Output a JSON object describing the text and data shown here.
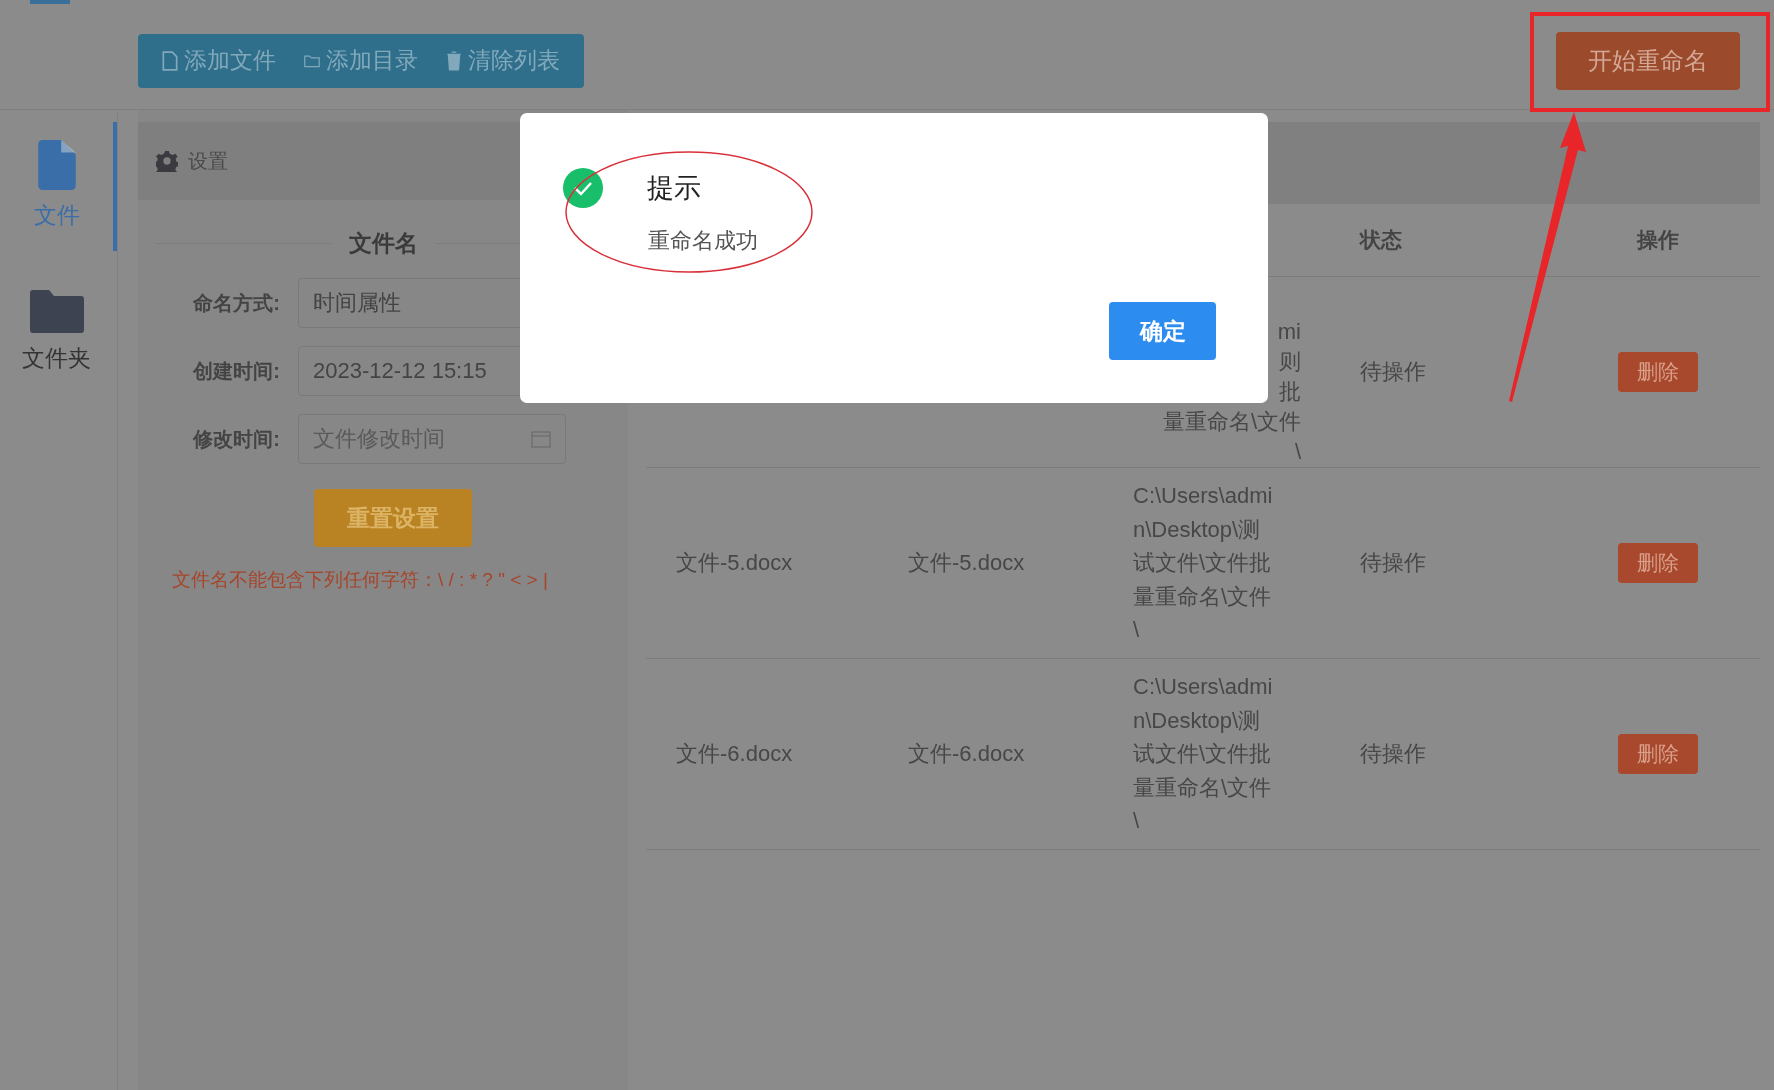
{
  "toolbar": {
    "buttons": [
      {
        "kind": "file",
        "label": "添加文件"
      },
      {
        "kind": "folder",
        "label": "添加目录"
      },
      {
        "kind": "trash",
        "label": "清除列表"
      }
    ]
  },
  "start_button": "开始重命名",
  "sidebar": {
    "items": [
      {
        "kind": "file",
        "label": "文件",
        "selected": true
      },
      {
        "kind": "folder",
        "label": "文件夹",
        "selected": false
      }
    ]
  },
  "settings": {
    "title": "设置",
    "section": "文件名",
    "fields": [
      {
        "kind": "select",
        "label": "命名方式:",
        "value": "时间属性"
      },
      {
        "kind": "date",
        "label": "创建时间:",
        "value": "2023-12-12 15:15"
      },
      {
        "kind": "date",
        "label": "修改时间:",
        "placeholder": "文件修改时间"
      }
    ],
    "reset_button": "重置设置",
    "warning": "文件名不能包含下列任何字符：\\ / : * ? \" < > |"
  },
  "table": {
    "columns": [
      "状态",
      "操作"
    ],
    "rows": [
      {
        "partial": true,
        "path_lines": [
          "mi",
          "则",
          "批",
          "量重命名\\文件",
          "\\"
        ],
        "status": "待操作",
        "action": "删除"
      },
      {
        "partial": false,
        "original_name": "文件-5.docx",
        "new_name": "文件-5.docx",
        "path_lines": [
          "C:\\Users\\admi",
          "n\\Desktop\\测",
          "试文件\\文件批",
          "量重命名\\文件",
          "\\"
        ],
        "status": "待操作",
        "action": "删除"
      },
      {
        "partial": false,
        "original_name": "文件-6.docx",
        "new_name": "文件-6.docx",
        "path_lines": [
          "C:\\Users\\admi",
          "n\\Desktop\\测",
          "试文件\\文件批",
          "量重命名\\文件",
          "\\"
        ],
        "status": "待操作",
        "action": "删除"
      }
    ]
  },
  "dialog": {
    "title": "提示",
    "message": "重命名成功",
    "confirm": "确定"
  }
}
